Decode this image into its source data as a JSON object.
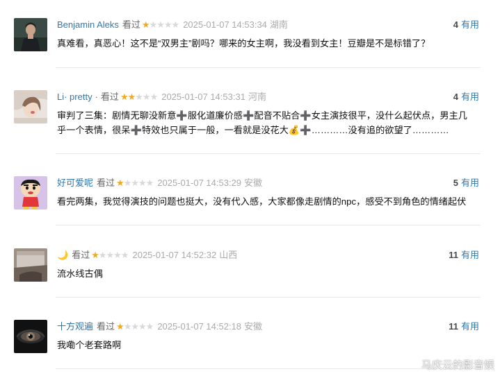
{
  "comments": [
    {
      "user": "Benjamin Aleks",
      "rating_label": "看过",
      "stars": 1,
      "time": "2025-01-07 14:53:34",
      "location": "湖南",
      "votes": "4",
      "vote_label": "有用",
      "text": "真难看，真恶心！这不是“双男主”剧吗？哪来的女主啊，我没看到女主！豆瓣是不是标错了？",
      "avatar_icon": "user-photo-man"
    },
    {
      "user": "Li· pretty",
      "separator": "·",
      "rating_label": "看过",
      "stars": 2,
      "time": "2025-01-07 14:53:31",
      "location": "河南",
      "votes": "4",
      "vote_label": "有用",
      "text": "审判了三集：剧情无聊没新意➕服化道廉价感➕配音不贴合➕女主演技很平，没什么起伏点，男主几乎一个表情，很呆➕特效也只属于一般，一看就是没花大💰➕…………没有追的欲望了…………",
      "avatar_icon": "user-photo-woman"
    },
    {
      "user": "好可爱呢",
      "rating_label": "看过",
      "stars": 1,
      "time": "2025-01-07 14:53:29",
      "location": "安徽",
      "votes": "5",
      "vote_label": "有用",
      "text": "看完两集，我觉得演技的问题也挺大，没有代入感，大家都像走剧情的npc，感受不到角色的情绪起伏",
      "avatar_icon": "cartoon-boy-avatar"
    },
    {
      "user": "🌙",
      "rating_label": "看过",
      "stars": 1,
      "time": "2025-01-07 14:52:32",
      "location": "山西",
      "votes": "11",
      "vote_label": "有用",
      "text": "流水线古偶",
      "avatar_icon": "window-photo-avatar"
    },
    {
      "user": "十方观遍",
      "rating_label": "看过",
      "stars": 1,
      "time": "2025-01-07 14:52:18",
      "location": "安徽",
      "votes": "11",
      "vote_label": "有用",
      "text": "我嘞个老套路啊",
      "avatar_icon": "eye-photo-avatar"
    }
  ],
  "watermark": "马庆云的影音娱",
  "colors": {
    "link": "#3377aa",
    "star_on": "#f4a81d",
    "star_off": "#d9d9d9",
    "meta": "#aaaaaa"
  }
}
